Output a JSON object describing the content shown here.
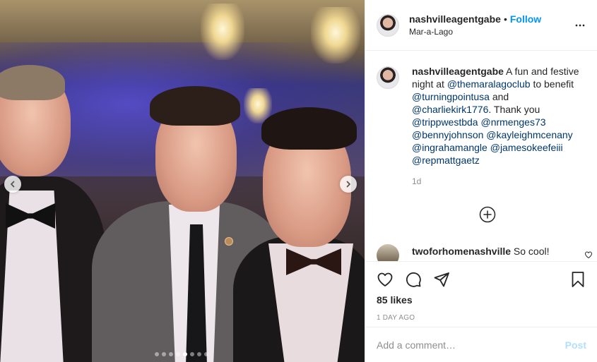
{
  "post": {
    "author": {
      "username": "nashvilleagentgabe",
      "follow_label": "Follow",
      "separator": "•",
      "location": "Mar-a-Lago"
    },
    "caption": {
      "username": "nashvilleagentgabe",
      "text_1": " A fun and festive night at ",
      "mention_1": "@themaralagoclub",
      "text_2": " to benefit ",
      "mention_2": "@turningpointusa",
      "text_3": " and ",
      "mention_3": "@charliekirk1776",
      "text_4": ". Thank you ",
      "mention_4": "@trippwestbda",
      "mention_5": "@nrmenges73",
      "mention_6": "@bennyjohnson",
      "mention_7": "@kayleighmcenany",
      "mention_8": "@ingrahamangle",
      "mention_9": "@jamesokeefeiii",
      "mention_10": "@repmattgaetz",
      "time": "1d"
    },
    "comment": {
      "username": "twoforhomenashville",
      "text": " So cool!"
    },
    "likes": "85 likes",
    "posted": "1 DAY AGO",
    "add_comment": {
      "placeholder": "Add a comment…",
      "post_label": "Post"
    },
    "carousel": {
      "total": 8,
      "active_index": 4
    }
  },
  "icons": {
    "more": "more-options-icon",
    "like": "heart-icon",
    "comment": "comment-icon",
    "share": "share-icon",
    "save": "bookmark-icon",
    "load_more": "plus-circle-icon",
    "prev": "chevron-left-icon",
    "next": "chevron-right-icon"
  },
  "colors": {
    "link": "#0095f6",
    "mention": "#00376b",
    "muted": "#8e8e8e",
    "post_disabled": "#b2dffc"
  }
}
